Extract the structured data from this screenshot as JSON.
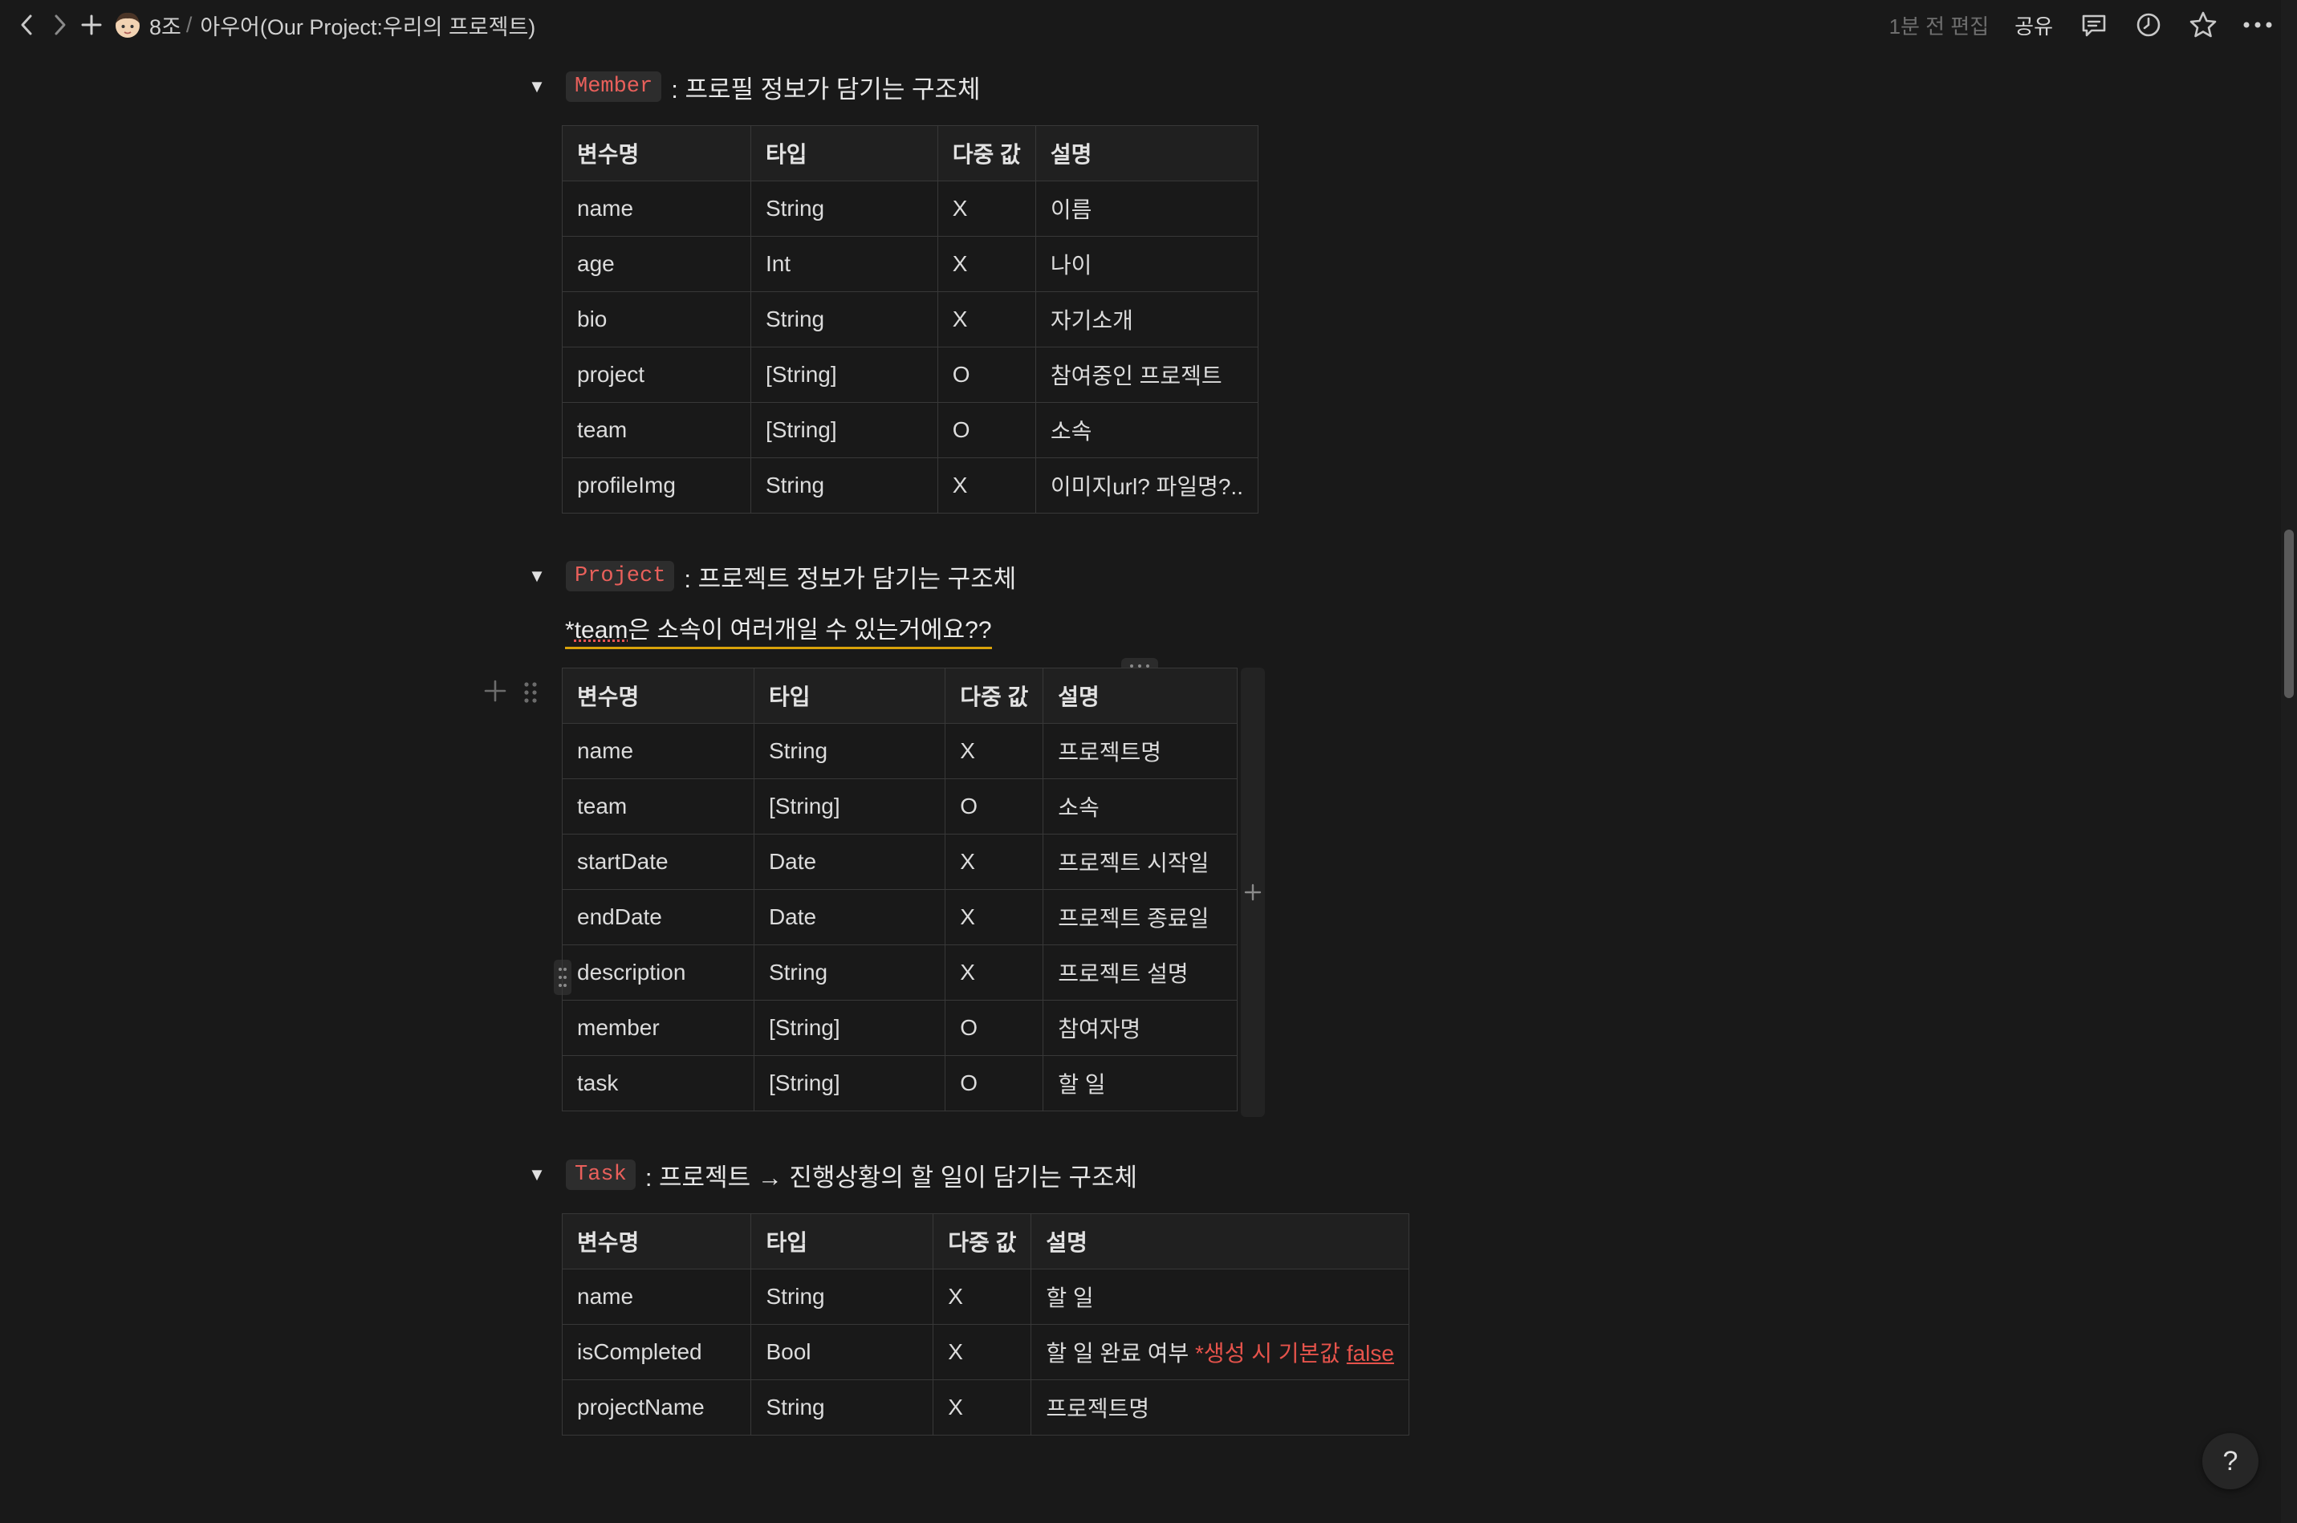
{
  "topbar": {
    "workspace": "8조",
    "separator": "/",
    "page_title": "아우어(Our Project:우리의 프로젝트)",
    "edited": "1분 전 편집",
    "share": "공유"
  },
  "sections": [
    {
      "code": "Member",
      "title": ": 프로필 정보가 담기는 구조체",
      "headers": [
        "변수명",
        "타입",
        "다중 값",
        "설명"
      ],
      "rows": [
        [
          "name",
          "String",
          "X",
          "이름"
        ],
        [
          "age",
          "Int",
          "X",
          "나이"
        ],
        [
          "bio",
          "String",
          "X",
          "자기소개"
        ],
        [
          "project",
          "[String]",
          "O",
          "참여중인 프로젝트"
        ],
        [
          "team",
          "[String]",
          "O",
          "소속"
        ],
        [
          "profileImg",
          "String",
          "X",
          "이미지url? 파일명?.."
        ]
      ]
    },
    {
      "code": "Project",
      "title": ": 프로젝트 정보가 담기는 구조체",
      "note_a": "*",
      "note_b": "team",
      "note_c": "은 소속이 여러개일 수 있는거에요??",
      "headers": [
        "변수명",
        "타입",
        "다중 값",
        "설명"
      ],
      "rows": [
        [
          "name",
          "String",
          "X",
          "프로젝트명"
        ],
        [
          "team",
          "[String]",
          "O",
          "소속"
        ],
        [
          "startDate",
          "Date",
          "X",
          "프로젝트 시작일"
        ],
        [
          "endDate",
          "Date",
          "X",
          "프로젝트 종료일"
        ],
        [
          "description",
          "String",
          "X",
          "프로젝트 설명"
        ],
        [
          "member",
          "[String]",
          "O",
          "참여자명"
        ],
        [
          "task",
          "[String]",
          "O",
          "할 일"
        ]
      ]
    },
    {
      "code": "Task",
      "title": ": 프로젝트 → 진행상황의 할 일이 담기는 구조체",
      "headers": [
        "변수명",
        "타입",
        "다중 값",
        "설명"
      ],
      "rows": [
        [
          "name",
          "String",
          "X",
          "할 일"
        ],
        [
          "isCompleted",
          "Bool",
          "X",
          "할 일 완료 여부 "
        ],
        [
          "projectName",
          "String",
          "X",
          "프로젝트명"
        ]
      ],
      "completed_note": "*생성 시 기본값 ",
      "completed_note_false": "false"
    }
  ],
  "help_label": "?"
}
